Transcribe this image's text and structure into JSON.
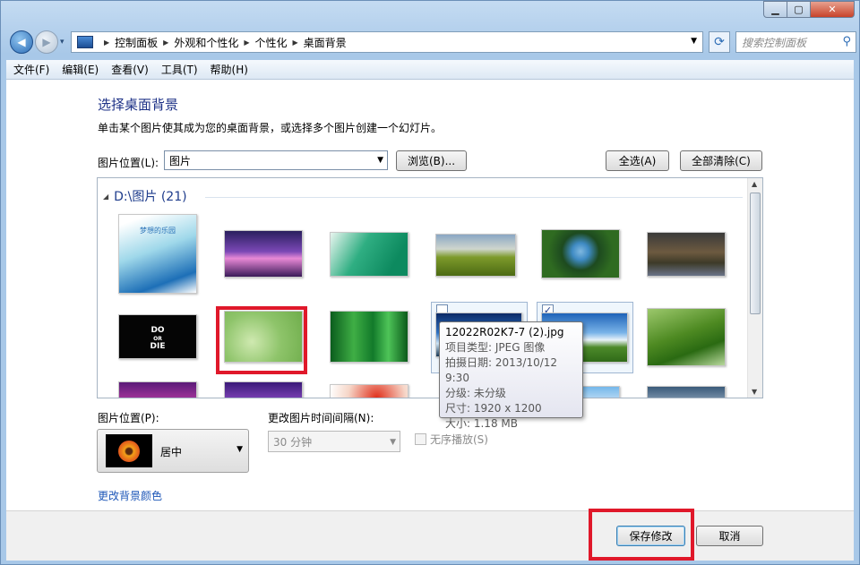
{
  "window": {
    "min": "▁",
    "max": "▢",
    "close": "✕"
  },
  "nav": {
    "back": "◀",
    "forward": "▶",
    "drop": "▾"
  },
  "breadcrumb": [
    "控制面板",
    "外观和个性化",
    "个性化",
    "桌面背景"
  ],
  "search": {
    "placeholder": "搜索控制面板"
  },
  "menu": [
    "文件(F)",
    "编辑(E)",
    "查看(V)",
    "工具(T)",
    "帮助(H)"
  ],
  "page": {
    "title": "选择桌面背景",
    "description": "单击某个图片使其成为您的桌面背景，或选择多个图片创建一个幻灯片。",
    "location_label": "图片位置(L):",
    "location_value": "图片",
    "browse": "浏览(B)...",
    "select_all": "全选(A)",
    "clear_all": "全部清除(C)"
  },
  "gallery": {
    "group": "D:\\图片 (21)",
    "thumb_title_1": "梦想的乐园",
    "thumb_title_2": "DO",
    "thumb_title_3": "OR",
    "thumb_title_4": "DIE"
  },
  "tooltip": {
    "name": "12022R02K7-7 (2).jpg",
    "type": "项目类型: JPEG 图像",
    "date": "拍摄日期: 2013/10/12 9:30",
    "rating": "分级: 未分级",
    "dims": "尺寸: 1920 x 1200",
    "size": "大小: 1.18 MB"
  },
  "position": {
    "label": "图片位置(P):",
    "value": "居中"
  },
  "interval": {
    "label": "更改图片时间间隔(N):",
    "value": "30 分钟"
  },
  "shuffle": "无序播放(S)",
  "color_link": "更改背景颜色",
  "footer": {
    "save": "保存修改",
    "cancel": "取消"
  }
}
